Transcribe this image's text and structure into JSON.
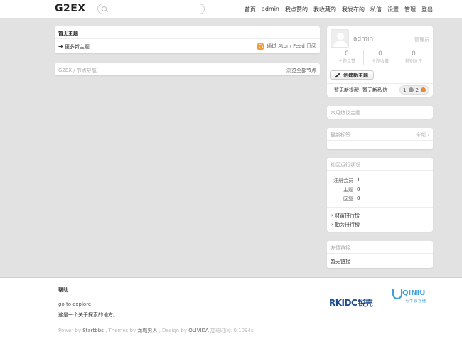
{
  "header": {
    "logo": "G2EX",
    "search_placeholder": "",
    "nav": [
      "首页",
      "admin",
      "我点赞的",
      "我收藏的",
      "我发布的",
      "私信",
      "设置",
      "管理",
      "登出"
    ]
  },
  "main": {
    "topics": {
      "title": "暂无主题",
      "more_link": "更多新主题",
      "rss_label": "通过 Atom Feed 订阅"
    },
    "nodes": {
      "crumb": "G2EX / 节点导航",
      "all_link": "浏览全部节点"
    }
  },
  "sidebar": {
    "user": {
      "name": "admin",
      "role": "管理员",
      "stats": [
        {
          "value": "0",
          "label": "主题点赞"
        },
        {
          "value": "0",
          "label": "主题收藏"
        },
        {
          "value": "0",
          "label": "特别关注"
        }
      ],
      "new_topic_button": "创建新主题",
      "no_remind": "暂无新提醒",
      "no_message": "暂无新私信",
      "badge_silver": "1",
      "badge_bronze": "2"
    },
    "hot_topics_title": "本月热议主题",
    "latest_tags": {
      "title": "最新标签",
      "all_link": "全部 ›"
    },
    "community": {
      "title": "社区运行状况",
      "rows": [
        {
          "key": "注册会员",
          "value": "1"
        },
        {
          "key": "主题",
          "value": "0"
        },
        {
          "key": "回复",
          "value": "0"
        }
      ],
      "rank_links": [
        "› 财富排行榜",
        "› 勤劳排行榜"
      ]
    },
    "friend_links": {
      "title": "友情链接",
      "empty": "暂无链接"
    }
  },
  "footer": {
    "help": "帮助",
    "explore": "go to explore",
    "desc": "这是一个关于探索的地方。",
    "power_prefix": "Power by ",
    "power_name": "Startbbs",
    "themes_prefix": " , Themes by ",
    "themes_name": "龙城男人",
    "design_prefix": " , Design by ",
    "design_name": "OLIVIDA",
    "load_time": "  加载时间: 0.1094s",
    "sponsor_rkidc": "RKIDC",
    "sponsor_rkidc_cn": "锐壳",
    "sponsor_qiniu": "QINIU",
    "sponsor_qiniu_sub": "七牛云存储"
  },
  "colors": {
    "page_bg": "#e2e2e2",
    "rss": "#f39c37",
    "rkidc": "#1b4a8c",
    "qiniu": "#3ca1d8"
  }
}
